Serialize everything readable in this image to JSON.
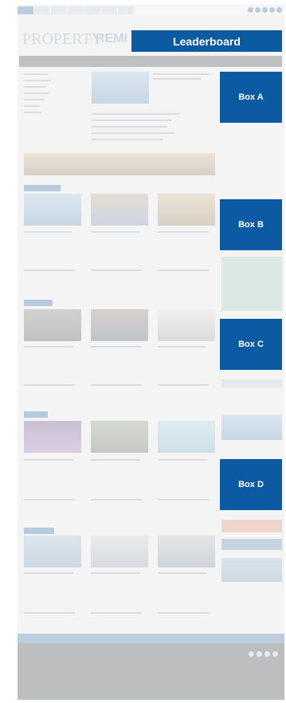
{
  "header": {
    "logo_main": "PROPERTY",
    "logo_sub": "REMI"
  },
  "ads": {
    "leaderboard": "Leaderboard",
    "box_a": "Box A",
    "box_b": "Box B",
    "box_c": "Box C",
    "box_d": "Box D"
  },
  "colors": {
    "ad_blue": "#0b5aa2",
    "nav_dark": "#3b3d42",
    "footer_dark": "#30353d"
  }
}
